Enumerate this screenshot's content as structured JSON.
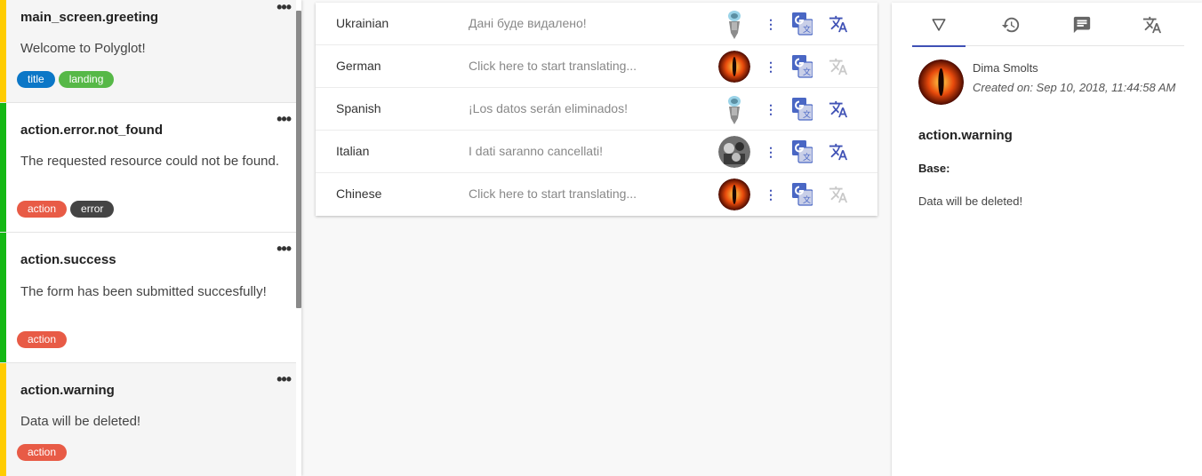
{
  "colors": {
    "tag_title": "#0b77c7",
    "tag_landing": "#56b847",
    "tag_action": "#e85b46",
    "tag_error": "#444444",
    "bar_yellow": "#ffcc00",
    "bar_green": "#14b814",
    "accent": "#3f51b5"
  },
  "keys": [
    {
      "name": "main_screen.greeting",
      "text": "Welcome to Polyglot!",
      "tags": [
        "title",
        "landing"
      ],
      "more": "•••"
    },
    {
      "name": "action.error.not_found",
      "text": "The requested resource could not be found.",
      "tags": [
        "action",
        "error"
      ],
      "more": "•••"
    },
    {
      "name": "action.success",
      "text": "The form has been submitted succesfully!",
      "tags": [
        "action"
      ],
      "more": "•••"
    },
    {
      "name": "action.warning",
      "text": "Data will be deleted!",
      "tags": [
        "action"
      ],
      "more": "•••"
    }
  ],
  "translations": [
    {
      "language": "Ukrainian",
      "text": "Дані буде видалено!",
      "avatar": "robot-avatar",
      "machine_translate_active": true
    },
    {
      "language": "German",
      "text": "Click here to start translating...",
      "avatar": "eye-avatar",
      "machine_translate_active": false
    },
    {
      "language": "Spanish",
      "text": "¡Los datos serán eliminados!",
      "avatar": "robot-avatar",
      "machine_translate_active": true
    },
    {
      "language": "Italian",
      "text": "I dati saranno cancellati!",
      "avatar": "photo-avatar",
      "machine_translate_active": true
    },
    {
      "language": "Chinese",
      "text": "Click here to start translating...",
      "avatar": "eye-avatar",
      "machine_translate_active": false
    }
  ],
  "detail": {
    "tabs": [
      "filter-icon",
      "history-icon",
      "comment-icon",
      "translate-icon"
    ],
    "active_tab": 0,
    "author": "Dima Smolts",
    "created": "Created on: Sep 10, 2018, 11:44:58 AM",
    "key": "action.warning",
    "base_label": "Base:",
    "base_text": "Data will be deleted!"
  }
}
